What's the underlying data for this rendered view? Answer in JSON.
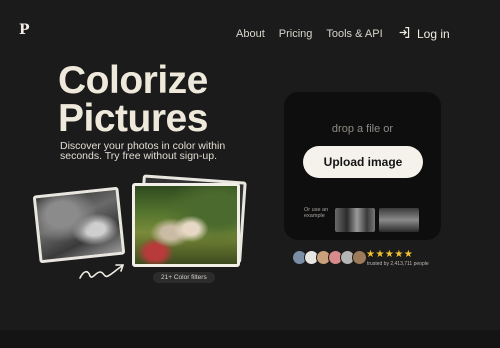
{
  "header": {
    "logo": "P",
    "nav": [
      "About",
      "Pricing",
      "Tools & API"
    ],
    "login_label": "Log in"
  },
  "hero": {
    "title_line1": "Colorize",
    "title_line2": "Pictures",
    "subtitle": "Discover your photos in color within seconds. Try free without sign-up."
  },
  "photos": {
    "filters_badge": "21+ Color filters"
  },
  "upload": {
    "drop_text": "drop a file or",
    "button_label": "Upload image",
    "example_label": "Or use an example"
  },
  "trust": {
    "stars": "★★★★★",
    "rating": 5,
    "trusted_text": "trusted by 2,413,711 people",
    "avatar_colors": [
      "#7a8fa6",
      "#e8e6e2",
      "#c9a27a",
      "#d98a8a",
      "#b5b5b5",
      "#9c7a5a"
    ]
  },
  "colors": {
    "background": "#1b1b1b",
    "card": "#0e0e0e",
    "button": "#f5f2ec",
    "title": "#efe9dc",
    "star": "#f2c230"
  }
}
